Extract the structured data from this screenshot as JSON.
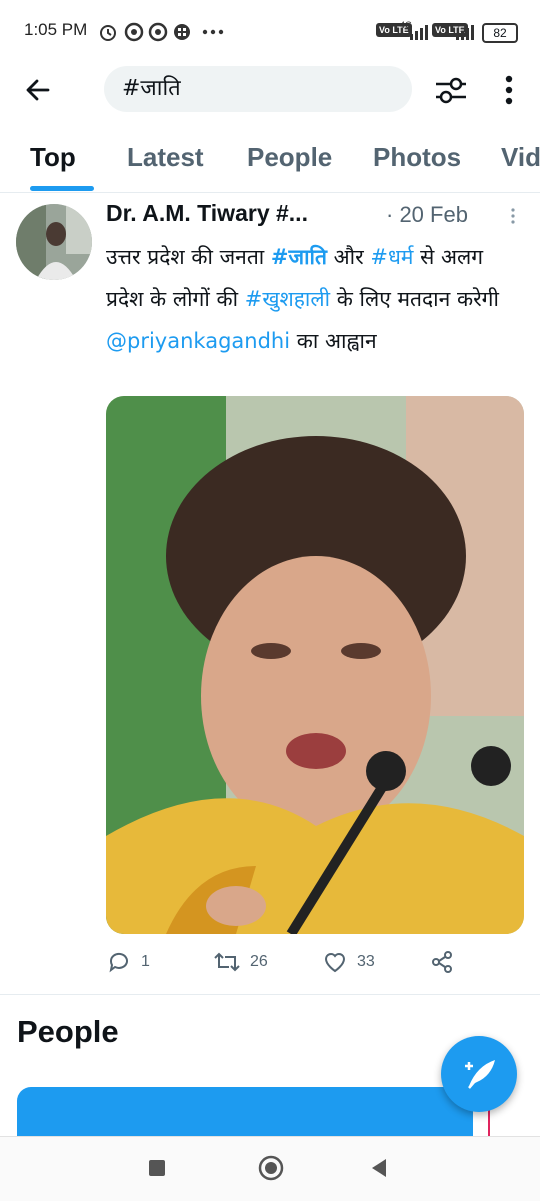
{
  "status_bar": {
    "time": "1:05 PM",
    "icons": [
      "alarm-icon",
      "chrome-icon",
      "chrome-icon",
      "app-icon",
      "more-dots-icon"
    ],
    "network_labels": [
      "Vo LTE",
      "4G",
      "Vo LTE"
    ],
    "battery": "82"
  },
  "header": {
    "search_query": "#जाति",
    "icons": [
      "back-arrow-icon",
      "filter-icon",
      "more-vertical-icon"
    ]
  },
  "tabs": [
    {
      "label": "Top"
    },
    {
      "label": "Latest"
    },
    {
      "label": "People"
    },
    {
      "label": "Photos"
    },
    {
      "label": "Vid"
    }
  ],
  "tweet": {
    "author": "Dr. A.M. Tiwary #...",
    "date": "· 20 Feb",
    "text": {
      "t1": "उत्तर प्रदेश की जनता ",
      "h1": "#जाति",
      "t2": " और ",
      "h2": "#धर्म",
      "t3": " से अलग प्रदेश के लोगों की ",
      "h3": "#खुशहाली",
      "t4": " के लिए मतदान करेगी ",
      "mention": "@priyankagandhi",
      "t5": " का आह्वान"
    },
    "actions": {
      "replies": "1",
      "retweets": "26",
      "likes": "33"
    }
  },
  "people_section": {
    "title": "People"
  },
  "colors": {
    "accent": "#1d9bf0",
    "text": "#0f1419",
    "muted": "#536471"
  },
  "nav_bar": {
    "icons": [
      "recents-square-icon",
      "home-circle-icon",
      "back-triangle-icon"
    ]
  }
}
